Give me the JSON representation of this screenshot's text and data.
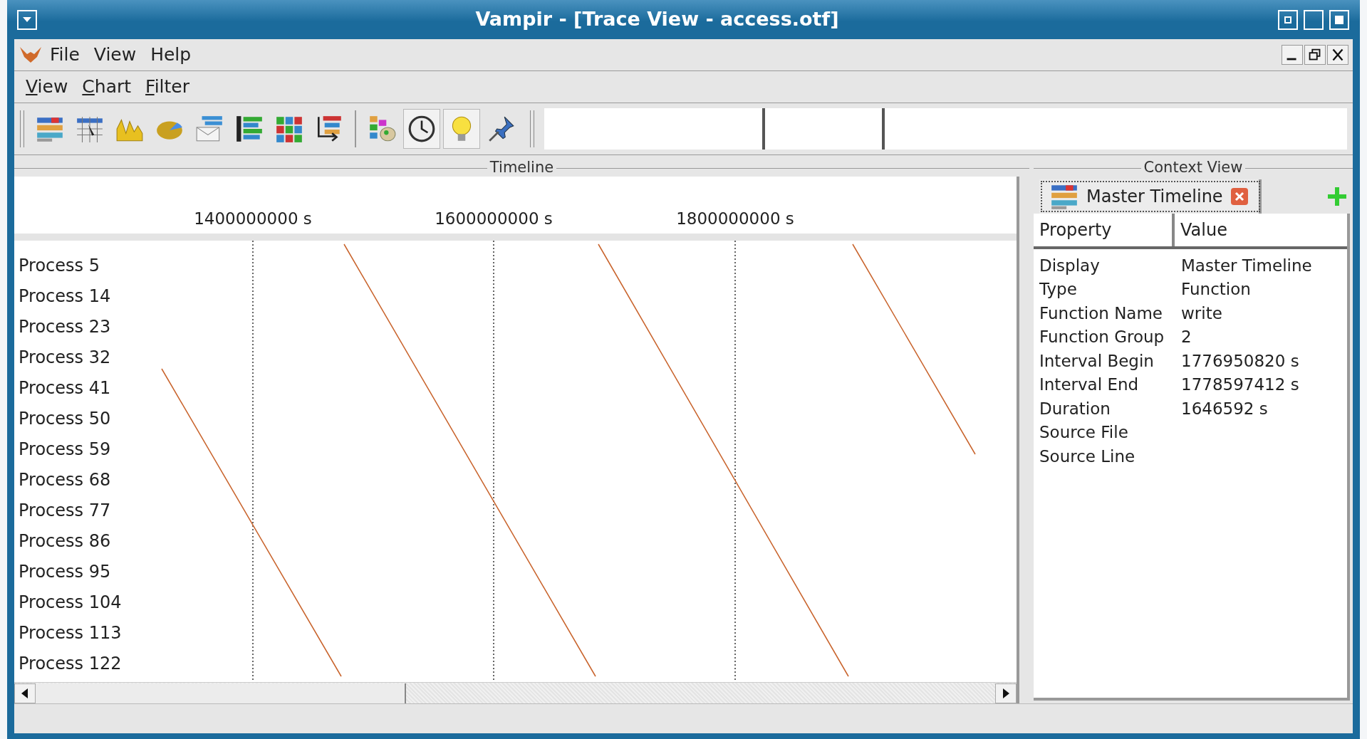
{
  "window": {
    "title": "Vampir - [Trace View - access.otf]"
  },
  "main_menu": [
    "File",
    "View",
    "Help"
  ],
  "view_menu": [
    "View",
    "Chart",
    "Filter"
  ],
  "toolbar": {
    "charts": [
      {
        "kind": "timeline",
        "pressed": false
      },
      {
        "kind": "process",
        "pressed": false
      },
      {
        "kind": "counter",
        "pressed": false
      },
      {
        "kind": "pie",
        "pressed": false
      },
      {
        "kind": "message",
        "pressed": false
      },
      {
        "kind": "summary",
        "pressed": false
      },
      {
        "kind": "matrix",
        "pressed": false
      },
      {
        "kind": "calltree",
        "pressed": false
      }
    ],
    "tools": [
      {
        "kind": "groups",
        "pressed": false
      },
      {
        "kind": "clock",
        "pressed": true
      },
      {
        "kind": "bulb",
        "pressed": true
      },
      {
        "kind": "pin",
        "pressed": false
      }
    ]
  },
  "timeline": {
    "title": "Timeline",
    "ticks": [
      "1400000000 s",
      "1600000000 s",
      "1800000000 s"
    ],
    "processes": [
      "Process 5",
      "Process 14",
      "Process 23",
      "Process 32",
      "Process 41",
      "Process 50",
      "Process 59",
      "Process 68",
      "Process 77",
      "Process 86",
      "Process 95",
      "Process 104",
      "Process 113",
      "Process 122"
    ]
  },
  "context_view": {
    "title": "Context View",
    "tab": {
      "label": "Master Timeline",
      "selected": true
    },
    "columns": [
      "Property",
      "Value"
    ],
    "rows": [
      {
        "property": "Display",
        "value": "Master Timeline"
      },
      {
        "property": "Type",
        "value": "Function"
      },
      {
        "property": "Function Name",
        "value": "write"
      },
      {
        "property": "Function Group",
        "value": "2"
      },
      {
        "property": "Interval Begin",
        "value": "1776950820 s"
      },
      {
        "property": "Interval End",
        "value": "1778597412 s"
      },
      {
        "property": "Duration",
        "value": "1646592 s"
      },
      {
        "property": "Source File"
      },
      {
        "property": "Source Line"
      }
    ]
  }
}
